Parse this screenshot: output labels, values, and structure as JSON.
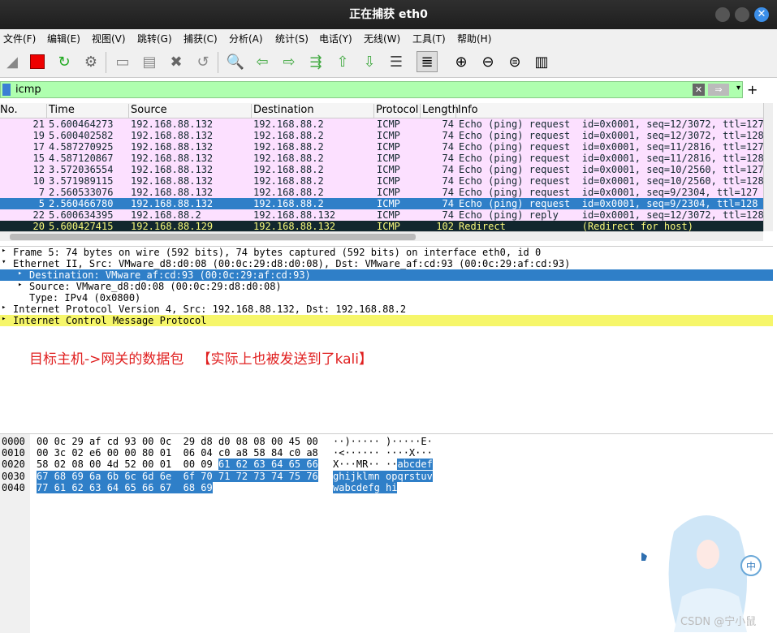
{
  "window": {
    "title": "正在捕获 eth0"
  },
  "menu": [
    "文件(F)",
    "编辑(E)",
    "视图(V)",
    "跳转(G)",
    "捕获(C)",
    "分析(A)",
    "统计(S)",
    "电话(Y)",
    "无线(W)",
    "工具(T)",
    "帮助(H)"
  ],
  "filter": {
    "value": "icmp"
  },
  "columns": [
    "No.",
    "Time",
    "Source",
    "Destination",
    "Protocol",
    "Length",
    "Info"
  ],
  "packets": [
    {
      "no": "21",
      "time": "5.600464273",
      "src": "192.168.88.132",
      "dst": "192.168.88.2",
      "proto": "ICMP",
      "len": "74",
      "info": "Echo (ping) request  id=0x0001, seq=12/3072, ttl=127",
      "type": "req"
    },
    {
      "no": "19",
      "time": "5.600402582",
      "src": "192.168.88.132",
      "dst": "192.168.88.2",
      "proto": "ICMP",
      "len": "74",
      "info": "Echo (ping) request  id=0x0001, seq=12/3072, ttl=128",
      "type": "req"
    },
    {
      "no": "17",
      "time": "4.587270925",
      "src": "192.168.88.132",
      "dst": "192.168.88.2",
      "proto": "ICMP",
      "len": "74",
      "info": "Echo (ping) request  id=0x0001, seq=11/2816, ttl=127",
      "type": "req"
    },
    {
      "no": "15",
      "time": "4.587120867",
      "src": "192.168.88.132",
      "dst": "192.168.88.2",
      "proto": "ICMP",
      "len": "74",
      "info": "Echo (ping) request  id=0x0001, seq=11/2816, ttl=128",
      "type": "req"
    },
    {
      "no": "12",
      "time": "3.572036554",
      "src": "192.168.88.132",
      "dst": "192.168.88.2",
      "proto": "ICMP",
      "len": "74",
      "info": "Echo (ping) request  id=0x0001, seq=10/2560, ttl=127",
      "type": "req"
    },
    {
      "no": "10",
      "time": "3.571989115",
      "src": "192.168.88.132",
      "dst": "192.168.88.2",
      "proto": "ICMP",
      "len": "74",
      "info": "Echo (ping) request  id=0x0001, seq=10/2560, ttl=128",
      "type": "req"
    },
    {
      "no": "7",
      "time": "2.560533076",
      "src": "192.168.88.132",
      "dst": "192.168.88.2",
      "proto": "ICMP",
      "len": "74",
      "info": "Echo (ping) request  id=0x0001, seq=9/2304, ttl=127",
      "type": "req"
    },
    {
      "no": "5",
      "time": "2.560466780",
      "src": "192.168.88.132",
      "dst": "192.168.88.2",
      "proto": "ICMP",
      "len": "74",
      "info": "Echo (ping) request  id=0x0001, seq=9/2304, ttl=128",
      "type": "sel"
    },
    {
      "no": "22",
      "time": "5.600634395",
      "src": "192.168.88.2",
      "dst": "192.168.88.132",
      "proto": "ICMP",
      "len": "74",
      "info": "Echo (ping) reply    id=0x0001, seq=12/3072, ttl=128",
      "type": "rep"
    },
    {
      "no": "20",
      "time": "5.600427415",
      "src": "192.168.88.129",
      "dst": "192.168.88.132",
      "proto": "ICMP",
      "len": "102",
      "info": "Redirect             (Redirect for host)",
      "type": "redir"
    }
  ],
  "details": [
    {
      "text": "Frame 5: 74 bytes on wire (592 bits), 74 bytes captured (592 bits) on interface eth0, id 0",
      "indent": 0,
      "arrow": "▸",
      "style": ""
    },
    {
      "text": "Ethernet II, Src: VMware_d8:d0:08 (00:0c:29:d8:d0:08), Dst: VMware_af:cd:93 (00:0c:29:af:cd:93)",
      "indent": 0,
      "arrow": "▾",
      "style": ""
    },
    {
      "text": "Destination: VMware_af:cd:93 (00:0c:29:af:cd:93)",
      "indent": 1,
      "arrow": "▸",
      "style": "sel"
    },
    {
      "text": "Source: VMware_d8:d0:08 (00:0c:29:d8:d0:08)",
      "indent": 1,
      "arrow": "▸",
      "style": ""
    },
    {
      "text": "Type: IPv4 (0x0800)",
      "indent": 1,
      "arrow": "",
      "style": ""
    },
    {
      "text": "Internet Protocol Version 4, Src: 192.168.88.132, Dst: 192.168.88.2",
      "indent": 0,
      "arrow": "▸",
      "style": ""
    },
    {
      "text": "Internet Control Message Protocol",
      "indent": 0,
      "arrow": "▸",
      "style": "hl"
    }
  ],
  "annotation": "目标主机->网关的数据包   【实际上也被发送到了kali】",
  "hex": [
    {
      "off": "0000",
      "bytes": "00 0c 29 af cd 93 00 0c  29 d8 d0 08 08 00 45 00",
      "hlbytes": "",
      "ascii": "··)····· )·····E·",
      "hlascii": ""
    },
    {
      "off": "0010",
      "bytes": "00 3c 02 e6 00 00 80 01  06 04 c0 a8 58 84 c0 a8",
      "hlbytes": "",
      "ascii": "·<······ ····X···",
      "hlascii": ""
    },
    {
      "off": "0020",
      "bytes": "58 02 08 00 4d 52 00 01  00 09 ",
      "hlbytes": "61 62 63 64 65 66",
      "ascii": "X···MR·· ··",
      "hlascii": "abcdef"
    },
    {
      "off": "0030",
      "bytes": "",
      "hlbytes": "67 68 69 6a 6b 6c 6d 6e  6f 70 71 72 73 74 75 76",
      "ascii": "",
      "hlascii": "ghijklmn opqrstuv"
    },
    {
      "off": "0040",
      "bytes": "",
      "hlbytes": "77 61 62 63 64 65 66 67  68 69",
      "ascii": "",
      "hlascii": "wabcdefg hi"
    }
  ],
  "watermark": "CSDN @宁小鼠"
}
